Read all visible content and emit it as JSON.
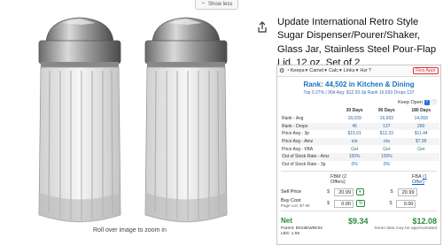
{
  "top": {
    "show_less": "Show less"
  },
  "gallery": {
    "rollover_hint": "Roll over image to zoom in"
  },
  "product": {
    "title": "Update International Retro Style Sugar Dispenser/Pourer/Shaker, Glass Jar, Stainless Steel Pour-Flap Lid, 12 oz, Set of 2"
  },
  "keepa": {
    "toolbar": [
      "Keepa",
      "Camel",
      "Calc",
      "Links",
      "Hzr"
    ],
    "req_appr": "Req Appr",
    "rank_label": "Rank:",
    "rank_value": "44,502 in Kitchen & Dining",
    "rank_info": "Top 0.27% | 90d Avg: $12.33-3p  Rank 16,693  Drops 137",
    "keep_open": "Keep Open",
    "table": {
      "headers": [
        "",
        "30 Days",
        "90 Days",
        "180 Days"
      ],
      "rows": [
        {
          "label": "Rank - Avg",
          "v": [
            "18,039",
            "16,693",
            "14,068"
          ]
        },
        {
          "label": "Rank - Drops",
          "v": [
            "45",
            "137",
            "280"
          ]
        },
        {
          "label": "Price Avg - 3p",
          "v": [
            "$15.01",
            "$12.33",
            "$11.44"
          ]
        },
        {
          "label": "Price Avg - Amz",
          "v": [
            "n/a",
            "n/a",
            "$7.99"
          ]
        },
        {
          "label": "Price Avg - FBA",
          "v": [
            "Get",
            "Get",
            "Get"
          ]
        },
        {
          "label": "Out of Stock Rate - Amz",
          "v": [
            "100%",
            "100%",
            ""
          ]
        },
        {
          "label": "Out of Stock Rate - 3p",
          "v": [
            "0%",
            "0%",
            ""
          ]
        }
      ]
    },
    "calc": {
      "fbm_header": "FBM (2 Offers)",
      "fba_header": "FBA",
      "fba_link": "(1 Offer)",
      "sell_price_label": "Sell Price",
      "sell_price_fbm": "20.99",
      "sell_price_fba": "20.99",
      "buy_cost_label": "Buy Cost",
      "buy_cost_sub": "Page List: $7.99",
      "buy_cost_fbm": "0.00",
      "buy_cost_fba": "0.00",
      "net_label": "Net",
      "net_fbm": "$9.34",
      "net_fba": "$12.08",
      "parent": "Parent: B019EW9K02",
      "lbs": "LBS: 1.59",
      "note": "Some data may be approximated"
    }
  },
  "colors": {
    "accent_green": "#2b8a3e",
    "link_blue": "#1a5fa8",
    "rank_blue": "#1a73b8",
    "alert_red": "#dd3333"
  },
  "icons": [
    "chevron-up-icon",
    "share-icon",
    "keepa-logo-icon",
    "gear-icon",
    "checkbox-icon"
  ]
}
